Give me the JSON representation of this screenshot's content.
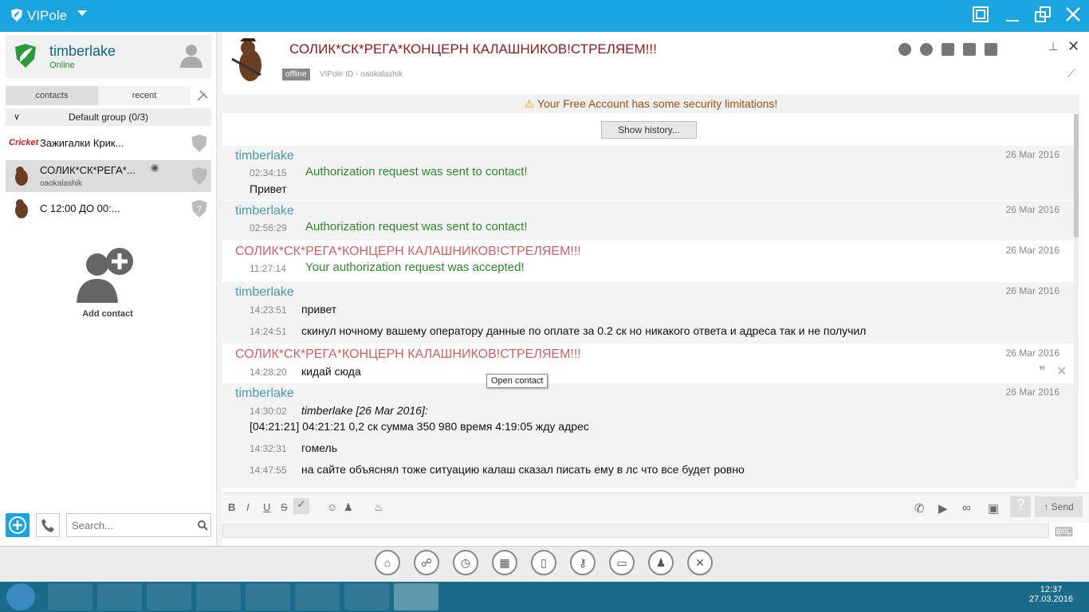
{
  "window": {
    "title": "VIPole",
    "buttons": [
      "restore-icon",
      "minimize-icon",
      "maximize-icon",
      "close-icon"
    ]
  },
  "profile": {
    "name": "timberlake",
    "status": "Online"
  },
  "tabs": [
    {
      "label": "contacts"
    },
    {
      "label": "recent"
    }
  ],
  "group": {
    "label": "Default group (0/3)"
  },
  "contacts": [
    {
      "name": "Зажигалки Крик...",
      "sub": "",
      "logo": "Cricket"
    },
    {
      "name": "СОЛИК*СК*РЕГА*...",
      "sub": "oaokalashik"
    },
    {
      "name": "С 12:00 ДО 00:...",
      "sub": ""
    }
  ],
  "add_contact": {
    "label": "Add contact"
  },
  "search": {
    "placeholder": "Search..."
  },
  "chat": {
    "title": "СОЛИК*СК*РЕГА*КОНЦЕРН КАЛАШНИКОВ!СТРЕЛЯЕМ!!!",
    "status": "offline",
    "vipole_id": "VIPole ID - oaokalashik",
    "warning": "Your Free Account has some security limitations!",
    "show_history": "Show history..."
  },
  "messages": [
    {
      "who": "timberlake",
      "date": "26 Mar 2016",
      "lines": [
        {
          "t": "02:34:15",
          "x": "Authorization request was sent to contact!"
        },
        {
          "t": "",
          "x": "Привет"
        }
      ]
    },
    {
      "who": "timberlake",
      "date": "26 Mar 2016",
      "lines": [
        {
          "t": "02:56:29",
          "x": "Authorization request was sent to contact!"
        }
      ]
    },
    {
      "who": "СОЛИК*СК*РЕГА*КОНЦЕРН КАЛАШНИКОВ!СТРЕЛЯЕМ!!!",
      "date": "26 Mar 2016",
      "lines": [
        {
          "t": "11:27:14",
          "x": "Your authorization request was accepted!"
        }
      ]
    },
    {
      "who": "timberlake",
      "date": "26 Mar 2016",
      "lines": [
        {
          "t": "14:23:51",
          "x": "привет"
        },
        {
          "t": "14:24:51",
          "x": "скинул ночному вашему оператору данные по оплате за 0.2 ск но никакого ответа и адреса так и не получил"
        }
      ]
    },
    {
      "who": "СОЛИК*СК*РЕГА*КОНЦЕРН КАЛАШНИКОВ!СТРЕЛЯЕМ!!!",
      "date": "26 Mar 2016",
      "lines": [
        {
          "t": "14:28:20",
          "x": "кидай сюда"
        }
      ]
    },
    {
      "who": "timberlake",
      "date": "26 Mar 2016",
      "lines": [
        {
          "t": "14:30:02",
          "x": "timberlake [26 Mar 2016]:"
        },
        {
          "t": "",
          "x": "[04:21:21] 04:21:21 0,2 ск сумма 350 980 время 4:19:05 жду адрес"
        },
        {
          "t": "14:32:31",
          "x": "гомель"
        },
        {
          "t": "14:47:55",
          "x": "на сайте объяснял тоже ситуацию калаш сказал писать ему в лс что все будет ровно"
        }
      ]
    }
  ],
  "tooltip": "Open contact",
  "toolbar": {
    "bold": "B",
    "italic": "I",
    "underline": "U",
    "strike": "S",
    "send": "Send"
  },
  "taskbar": {
    "time": "12:37",
    "date": "27.03.2016"
  },
  "colors": {
    "accent": "#1aa5e0",
    "self": "#4a9aaa",
    "contact": "#d06060",
    "system": "#2c8a2c"
  }
}
